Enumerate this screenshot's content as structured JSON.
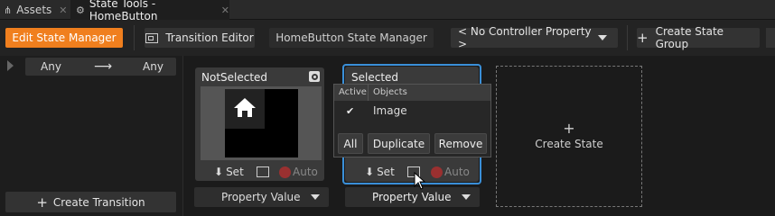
{
  "tabs": [
    {
      "label": "Assets",
      "close": "✕",
      "icon": "assets-icon"
    },
    {
      "label": "State Tools - HomeButton",
      "close": "✕",
      "icon": "state-tools-icon"
    }
  ],
  "toolbar": {
    "edit_state_manager": "Edit State Manager",
    "transition_editor": "Transition Editor",
    "state_manager_name": "HomeButton State Manager",
    "controller_property": "< No Controller Property >",
    "create_state_group": "Create State Group"
  },
  "transition": {
    "from": "Any",
    "to": "Any",
    "create_transition": "Create Transition"
  },
  "states": [
    {
      "title": "NotSelected",
      "set_label": "Set",
      "auto_label": "Auto",
      "property_value": "Property Value"
    },
    {
      "title": "Selected",
      "set_label": "Set",
      "auto_label": "Auto",
      "property_value": "Property Value"
    }
  ],
  "popup": {
    "col_active": "Active",
    "col_objects": "Objects",
    "row_object": "Image",
    "row_checked": true,
    "btn_all": "All",
    "btn_duplicate": "Duplicate",
    "btn_remove": "Remove"
  },
  "create_state": "Create State",
  "colors": {
    "accent": "#f07f1e",
    "selection": "#3a8fd8"
  }
}
